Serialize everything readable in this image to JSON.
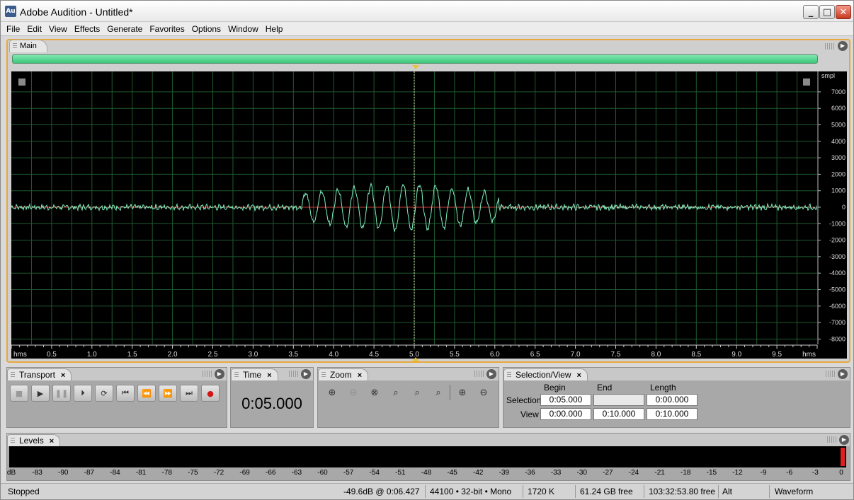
{
  "window": {
    "title": "Adobe Audition - Untitled*",
    "icon_text": "Au",
    "min_glyph": "_",
    "max_glyph": "□",
    "close_glyph": "✕"
  },
  "menu": [
    "File",
    "Edit",
    "View",
    "Effects",
    "Generate",
    "Favorites",
    "Options",
    "Window",
    "Help"
  ],
  "main_panel": {
    "tab": "Main",
    "y_unit": "smpl",
    "y_ticks": [
      "7000",
      "6000",
      "5000",
      "4000",
      "3000",
      "2000",
      "1000",
      "0",
      "-1000",
      "-2000",
      "-3000",
      "-4000",
      "-5000",
      "-6000",
      "-7000",
      "-8000"
    ],
    "x_unit": "hms",
    "x_ticks": [
      "0.5",
      "1.0",
      "1.5",
      "2.0",
      "2.5",
      "3.0",
      "3.5",
      "4.0",
      "4.5",
      "5.0",
      "5.5",
      "6.0",
      "6.5",
      "7.0",
      "7.5",
      "8.0",
      "8.5",
      "9.0",
      "9.5"
    ],
    "playhead_position_s": 5.0,
    "view_duration_s": 10.0
  },
  "transport": {
    "tab": "Transport",
    "buttons": [
      {
        "name": "stop",
        "glyph": "■",
        "enabled": false
      },
      {
        "name": "play",
        "glyph": "▶",
        "enabled": true
      },
      {
        "name": "pause",
        "glyph": "❚❚",
        "enabled": false
      },
      {
        "name": "play-from-cursor",
        "glyph": "⏵",
        "enabled": true
      },
      {
        "name": "loop",
        "glyph": "⟳",
        "enabled": true
      },
      {
        "name": "go-to-start",
        "glyph": "⏮",
        "enabled": true
      },
      {
        "name": "rewind",
        "glyph": "⏪",
        "enabled": true
      },
      {
        "name": "fast-forward",
        "glyph": "⏩",
        "enabled": true
      },
      {
        "name": "go-to-end",
        "glyph": "⏭",
        "enabled": true
      },
      {
        "name": "record",
        "glyph": "●",
        "enabled": true
      }
    ]
  },
  "time": {
    "tab": "Time",
    "value": "0:05.000"
  },
  "zoom": {
    "tab": "Zoom",
    "buttons": [
      {
        "name": "zoom-in-horizontal",
        "glyph": "⊕",
        "enabled": true
      },
      {
        "name": "zoom-out-horizontal",
        "glyph": "⊖",
        "enabled": false
      },
      {
        "name": "zoom-out-full",
        "glyph": "⊗",
        "enabled": true
      },
      {
        "name": "zoom-to-selection",
        "glyph": "⌕",
        "enabled": true
      },
      {
        "name": "zoom-to-left-edge",
        "glyph": "⌕",
        "enabled": true
      },
      {
        "name": "zoom-to-right-edge",
        "glyph": "⌕",
        "enabled": true
      },
      {
        "name": "zoom-in-vertical",
        "glyph": "⊕",
        "enabled": true
      },
      {
        "name": "zoom-out-vertical",
        "glyph": "⊖",
        "enabled": true
      }
    ]
  },
  "selection_view": {
    "tab": "Selection/View",
    "headers": {
      "begin": "Begin",
      "end": "End",
      "length": "Length"
    },
    "selection": {
      "label": "Selection",
      "begin": "0:05.000",
      "end": "",
      "length": "0:00.000"
    },
    "view": {
      "label": "View",
      "begin": "0:00.000",
      "end": "0:10.000",
      "length": "0:10.000"
    }
  },
  "levels": {
    "tab": "Levels",
    "scale": [
      "dB",
      "-83",
      "-90",
      "-87",
      "-84",
      "-81",
      "-78",
      "-75",
      "-72",
      "-69",
      "-66",
      "-63",
      "-60",
      "-57",
      "-54",
      "-51",
      "-48",
      "-45",
      "-42",
      "-39",
      "-36",
      "-33",
      "-30",
      "-27",
      "-24",
      "-21",
      "-18",
      "-15",
      "-12",
      "-9",
      "-6",
      "-3",
      "0"
    ]
  },
  "status": {
    "state": "Stopped",
    "cursor_level": "-49.6dB @ 0:06.427",
    "format": "44100 • 32-bit • Mono",
    "size": "1720 K",
    "disk_free": "61.24 GB free",
    "time_free": "103:32:53.80 free",
    "modifier": "Alt",
    "view_mode": "Waveform"
  },
  "colors": {
    "accent": "#e7a93c",
    "waveform": "#7ff0c0",
    "grid": "#1f5a2e",
    "centerline": "#c83c3c"
  }
}
